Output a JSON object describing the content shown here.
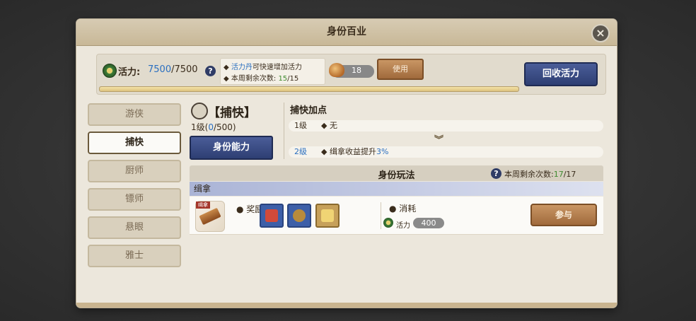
{
  "window": {
    "title": "身份百业"
  },
  "energy": {
    "label": "活力:",
    "current": "7500",
    "separator": "/",
    "max": "7500",
    "tip_line1_highlight": "活力丹",
    "tip_line1_rest": "可快速增加活力",
    "tip_line2_label": "本周剩余次数:",
    "tip_line2_current": "15",
    "tip_line2_max": "/15",
    "item_count": "18",
    "use_label": "使用",
    "recover_label": "回收活力",
    "progress_fraction": 1.0
  },
  "sidebar": {
    "items": [
      {
        "label": "游侠",
        "active": false
      },
      {
        "label": "捕快",
        "active": true
      },
      {
        "label": "厨师",
        "active": false
      },
      {
        "label": "镖师",
        "active": false
      },
      {
        "label": "悬眼",
        "active": false
      },
      {
        "label": "雅士",
        "active": false
      }
    ]
  },
  "role": {
    "title": "【捕快】",
    "level_prefix": "1级(",
    "level_current": "0",
    "level_suffix": "/500)",
    "ability_label": "身份能力",
    "bonus_title": "捕快加点",
    "bonus_rows": [
      {
        "level": "1级",
        "desc": "无",
        "highlight": ""
      },
      {
        "level": "2级",
        "desc": "缉拿收益提升",
        "highlight": "3%"
      }
    ]
  },
  "play": {
    "title": "身份玩法",
    "count_label": "本周剩余次数:",
    "count_current": "17",
    "count_max": "/17",
    "section_label": "缉拿",
    "icon_tag": "缉拿",
    "reward_label": "奖励",
    "cost_label": "消耗",
    "cost_name": "活力",
    "cost_value": "400",
    "join_label": "参与"
  },
  "colors": {
    "accent_blue": "#2a6fc0",
    "accent_green": "#3f8a2f",
    "button_navy": "#2e3f73",
    "button_bronze": "#a06a3c"
  }
}
